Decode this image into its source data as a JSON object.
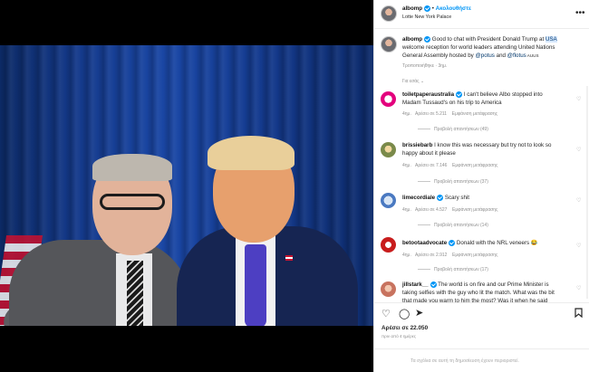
{
  "header": {
    "username": "albomp",
    "follow_label": "Ακολουθήστε",
    "location": "Lotte New York Palace",
    "more_icon": "more-horizontal-icon"
  },
  "caption": {
    "username": "albomp",
    "line1_before": "Good to chat with President Donald Trump at ",
    "line1_link": "USA",
    "line2": "welcome reception for world leaders attending United Nations",
    "line3_before": "General Assembly hosted by ",
    "line3_link1": "@potus",
    "line3_mid": " and ",
    "line3_link2": "@flotus",
    "line3_after": " AUUS",
    "edited": "Τροποποιήθηκε · 3ημ."
  },
  "section_label": "Για εσάς",
  "comments": [
    {
      "username": "toiletpaperaustralia",
      "line1": "I can't believe Albo stopped into",
      "line2": "Madam Tussaud's on his trip to America",
      "age": "4ημ.",
      "likes": "Αρέσει σε 5.211",
      "translate": "Εμφάνιση μετάφρασης",
      "replies": "Προβολή απαντήσεων (49)"
    },
    {
      "username": "brissiebarb",
      "line1": "I know this was necessary but try not to look so",
      "line2": "happy about it please",
      "age": "4ημ.",
      "likes": "Αρέσει σε 7.146",
      "translate": "Εμφάνιση μετάφρασης",
      "replies": "Προβολή απαντήσεων (37)"
    },
    {
      "username": "limecordiale",
      "line1": "Scary shit",
      "line2": "",
      "age": "4ημ.",
      "likes": "Αρέσει σε 4.527",
      "translate": "Εμφάνιση μετάφρασης",
      "replies": "Προβολή απαντήσεων (14)"
    },
    {
      "username": "betootaadvocate",
      "line1": "Donald with the NRL veneers 😂",
      "line2": "",
      "age": "4ημ.",
      "likes": "Αρέσει σε 2.912",
      "translate": "Εμφάνιση μετάφρασης",
      "replies": "Προβολή απαντήσεων (17)"
    },
    {
      "username": "jillstark__",
      "line1": "The world is on fire and our Prime Minister is",
      "line2": "taking selfies with the guy who lit the match. What was the bit",
      "line3": "that made you warm to him the most? Was it when he said",
      "age": "",
      "likes": "",
      "translate": "",
      "replies": ""
    }
  ],
  "actions": {
    "like_icon": "heart-icon",
    "comment_icon": "comment-icon",
    "share_icon": "send-icon",
    "save_icon": "bookmark-icon"
  },
  "likes_total": "Αρέσει σε 22.050",
  "posted_ago": "πριν από 4 ημέρες",
  "footer_text": "Τα σχόλια σε αυτή τη δημοσίευση έχουν περιοριστεί."
}
